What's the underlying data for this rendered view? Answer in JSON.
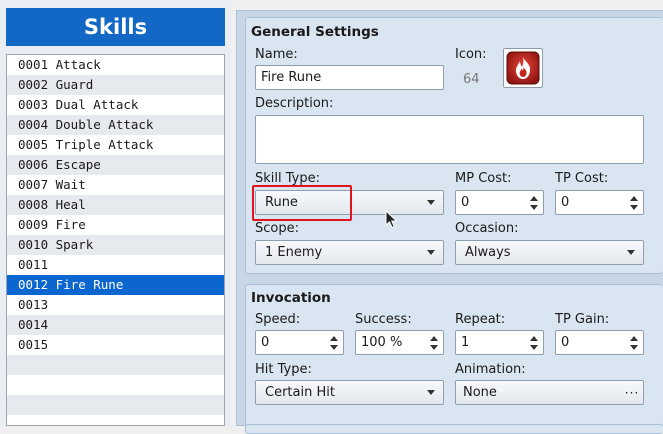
{
  "skills_panel": {
    "title": "Skills",
    "items": [
      {
        "label": "0001 Attack"
      },
      {
        "label": "0002 Guard"
      },
      {
        "label": "0003 Dual Attack"
      },
      {
        "label": "0004 Double Attack"
      },
      {
        "label": "0005 Triple Attack"
      },
      {
        "label": "0006 Escape"
      },
      {
        "label": "0007 Wait"
      },
      {
        "label": "0008 Heal"
      },
      {
        "label": "0009 Fire"
      },
      {
        "label": "0010 Spark"
      },
      {
        "label": "0011"
      },
      {
        "label": "0012 Fire Rune",
        "selected": true
      },
      {
        "label": "0013"
      },
      {
        "label": "0014"
      },
      {
        "label": "0015"
      }
    ]
  },
  "general": {
    "title": "General Settings",
    "name_label": "Name:",
    "name_value": "Fire Rune",
    "icon_label": "Icon:",
    "icon_index": "64",
    "icon_name": "fire-icon",
    "description_label": "Description:",
    "description_value": "",
    "skill_type_label": "Skill Type:",
    "skill_type_value": "Rune",
    "mp_cost_label": "MP Cost:",
    "mp_cost_value": "0",
    "tp_cost_label": "TP Cost:",
    "tp_cost_value": "0",
    "scope_label": "Scope:",
    "scope_value": "1 Enemy",
    "occasion_label": "Occasion:",
    "occasion_value": "Always"
  },
  "invocation": {
    "title": "Invocation",
    "speed_label": "Speed:",
    "speed_value": "0",
    "success_label": "Success:",
    "success_value": "100 %",
    "repeat_label": "Repeat:",
    "repeat_value": "1",
    "tp_gain_label": "TP Gain:",
    "tp_gain_value": "0",
    "hit_type_label": "Hit Type:",
    "hit_type_value": "Certain Hit",
    "animation_label": "Animation:",
    "animation_value": "None",
    "animation_button": "···"
  },
  "colors": {
    "header_blue": "#1268c4",
    "selection_blue": "#0c66d0",
    "highlight_red": "#e0141e",
    "panel_bg": "#d9e5f1"
  }
}
